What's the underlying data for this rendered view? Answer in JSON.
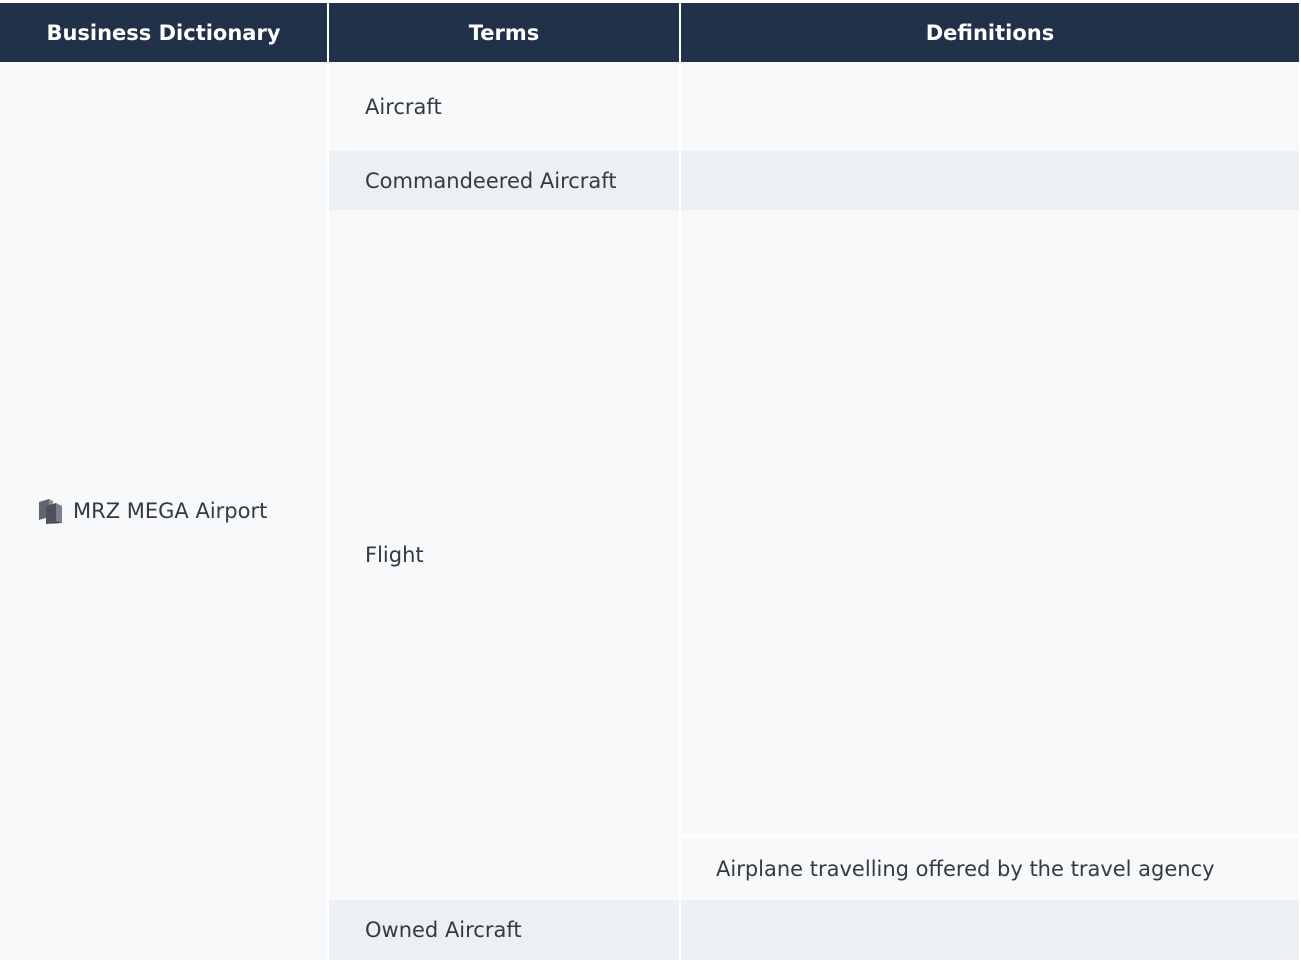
{
  "table": {
    "headers": [
      "Business Dictionary",
      "Terms",
      "Definitions"
    ],
    "dictionary": {
      "name": "MRZ MEGA Airport",
      "icon": "dictionary-book-icon"
    },
    "terms": [
      {
        "term": "Aircraft",
        "definition": ""
      },
      {
        "term": "Commandeered Aircraft",
        "definition": ""
      },
      {
        "term": "Flight",
        "definitions": [
          "",
          "Airplane travelling offered by the travel agency"
        ]
      },
      {
        "term": "Owned Aircraft",
        "definition": ""
      }
    ]
  },
  "colors": {
    "header_bg": "#213149",
    "header_text": "#ffffff",
    "row_light": "#f7f9fb",
    "row_dark": "#edf0f3",
    "text": "#343a40"
  }
}
